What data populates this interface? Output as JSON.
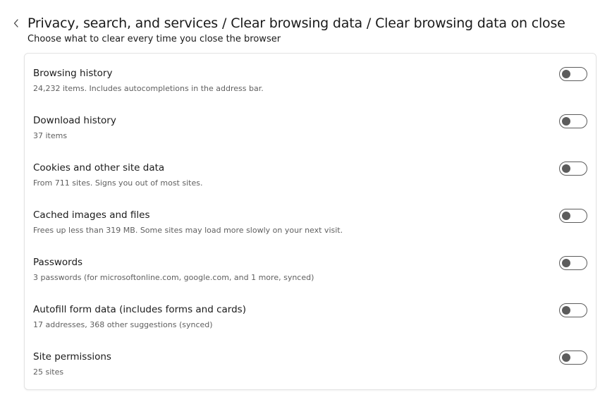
{
  "header": {
    "breadcrumb": [
      "Privacy, search, and services",
      "Clear browsing data",
      "Clear browsing data on close"
    ],
    "separator": "/",
    "subtitle": "Choose what to clear every time you close the browser"
  },
  "icons": {
    "back": "chevron-left-icon"
  },
  "colors": {
    "text": "#1a1a1a",
    "secondary_text": "#5f5f5f",
    "toggle_off": "#5c5c5c",
    "card_border": "#e3e3e3"
  },
  "items": [
    {
      "title": "Browsing history",
      "description": "24,232 items. Includes autocompletions in the address bar.",
      "enabled": false
    },
    {
      "title": "Download history",
      "description": "37 items",
      "enabled": false
    },
    {
      "title": "Cookies and other site data",
      "description": "From 711 sites. Signs you out of most sites.",
      "enabled": false
    },
    {
      "title": "Cached images and files",
      "description": "Frees up less than 319 MB. Some sites may load more slowly on your next visit.",
      "enabled": false
    },
    {
      "title": "Passwords",
      "description": "3 passwords (for microsoftonline.com, google.com, and 1 more, synced)",
      "enabled": false
    },
    {
      "title": "Autofill form data (includes forms and cards)",
      "description": "17 addresses, 368 other suggestions (synced)",
      "enabled": false
    },
    {
      "title": "Site permissions",
      "description": "25 sites",
      "enabled": false
    }
  ]
}
